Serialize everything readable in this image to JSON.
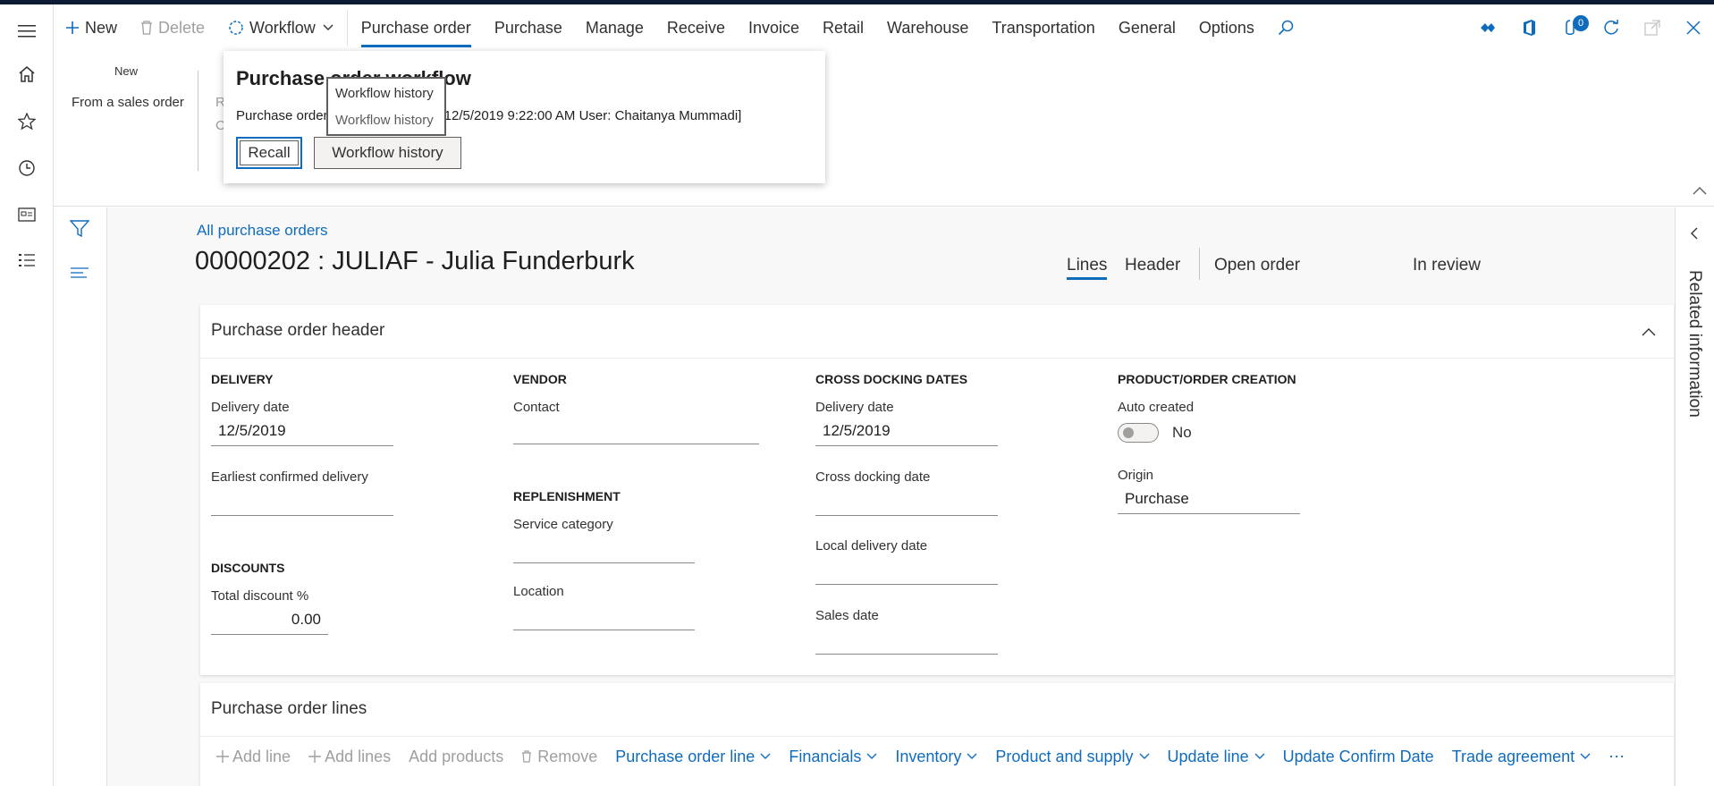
{
  "action_pane": {
    "new_label": "New",
    "delete_label": "Delete",
    "workflow_label": "Workflow",
    "tabs": [
      {
        "label": "Purchase order"
      },
      {
        "label": "Purchase"
      },
      {
        "label": "Manage"
      },
      {
        "label": "Receive"
      },
      {
        "label": "Invoice"
      },
      {
        "label": "Retail"
      },
      {
        "label": "Warehouse"
      },
      {
        "label": "Transportation"
      },
      {
        "label": "General"
      },
      {
        "label": "Options"
      }
    ],
    "notifications_count": "0"
  },
  "ribbon": {
    "new_group_title": "New",
    "from_sales_order": "From a sales order",
    "obscured_item_1": "R",
    "obscured_item_2": "C"
  },
  "workflow_popup": {
    "title": "Purchase order workflow",
    "status_text": "Purchase order [Last action taken: 12/5/2019 9:22:00 AM User: Chaitanya Mummadi]",
    "recall_label": "Recall",
    "workflow_history_label": "Workflow history",
    "tooltip_title": "Workflow history",
    "tooltip_desc": "Workflow history"
  },
  "page": {
    "breadcrumb": "All purchase orders",
    "title": "00000202 : JULIAF - Julia Funderburk",
    "view_lines": "Lines",
    "view_header": "Header",
    "status_open": "Open order",
    "status_review": "In review"
  },
  "header_card": {
    "title": "Purchase order header",
    "delivery": {
      "section": "DELIVERY",
      "delivery_date_label": "Delivery date",
      "delivery_date_value": "12/5/2019",
      "earliest_label": "Earliest confirmed delivery",
      "earliest_value": ""
    },
    "discounts": {
      "section": "DISCOUNTS",
      "total_label": "Total discount %",
      "total_value": "0.00"
    },
    "vendor": {
      "section": "VENDOR",
      "contact_label": "Contact",
      "contact_value": ""
    },
    "replenishment": {
      "section": "REPLENISHMENT",
      "service_label": "Service category",
      "location_label": "Location"
    },
    "cross_docking": {
      "section": "CROSS DOCKING DATES",
      "delivery_date_label": "Delivery date",
      "delivery_date_value": "12/5/2019",
      "cross_label": "Cross docking date",
      "local_label": "Local delivery date",
      "sales_label": "Sales date"
    },
    "product_order": {
      "section": "PRODUCT/ORDER CREATION",
      "auto_label": "Auto created",
      "auto_value": "No",
      "origin_label": "Origin",
      "origin_value": "Purchase"
    }
  },
  "lines_card": {
    "title": "Purchase order lines",
    "toolbar": {
      "add_line": "Add line",
      "add_lines": "Add lines",
      "add_products": "Add products",
      "remove": "Remove",
      "po_line": "Purchase order line",
      "financials": "Financials",
      "inventory": "Inventory",
      "product_supply": "Product and supply",
      "update_line": "Update line",
      "update_confirm": "Update Confirm Date",
      "trade_agreement": "Trade agreement",
      "more": "⋯"
    }
  },
  "related_info": "Related information",
  "colors": {
    "accent": "#0f6cbd",
    "topstrip": "#0d1a33"
  }
}
